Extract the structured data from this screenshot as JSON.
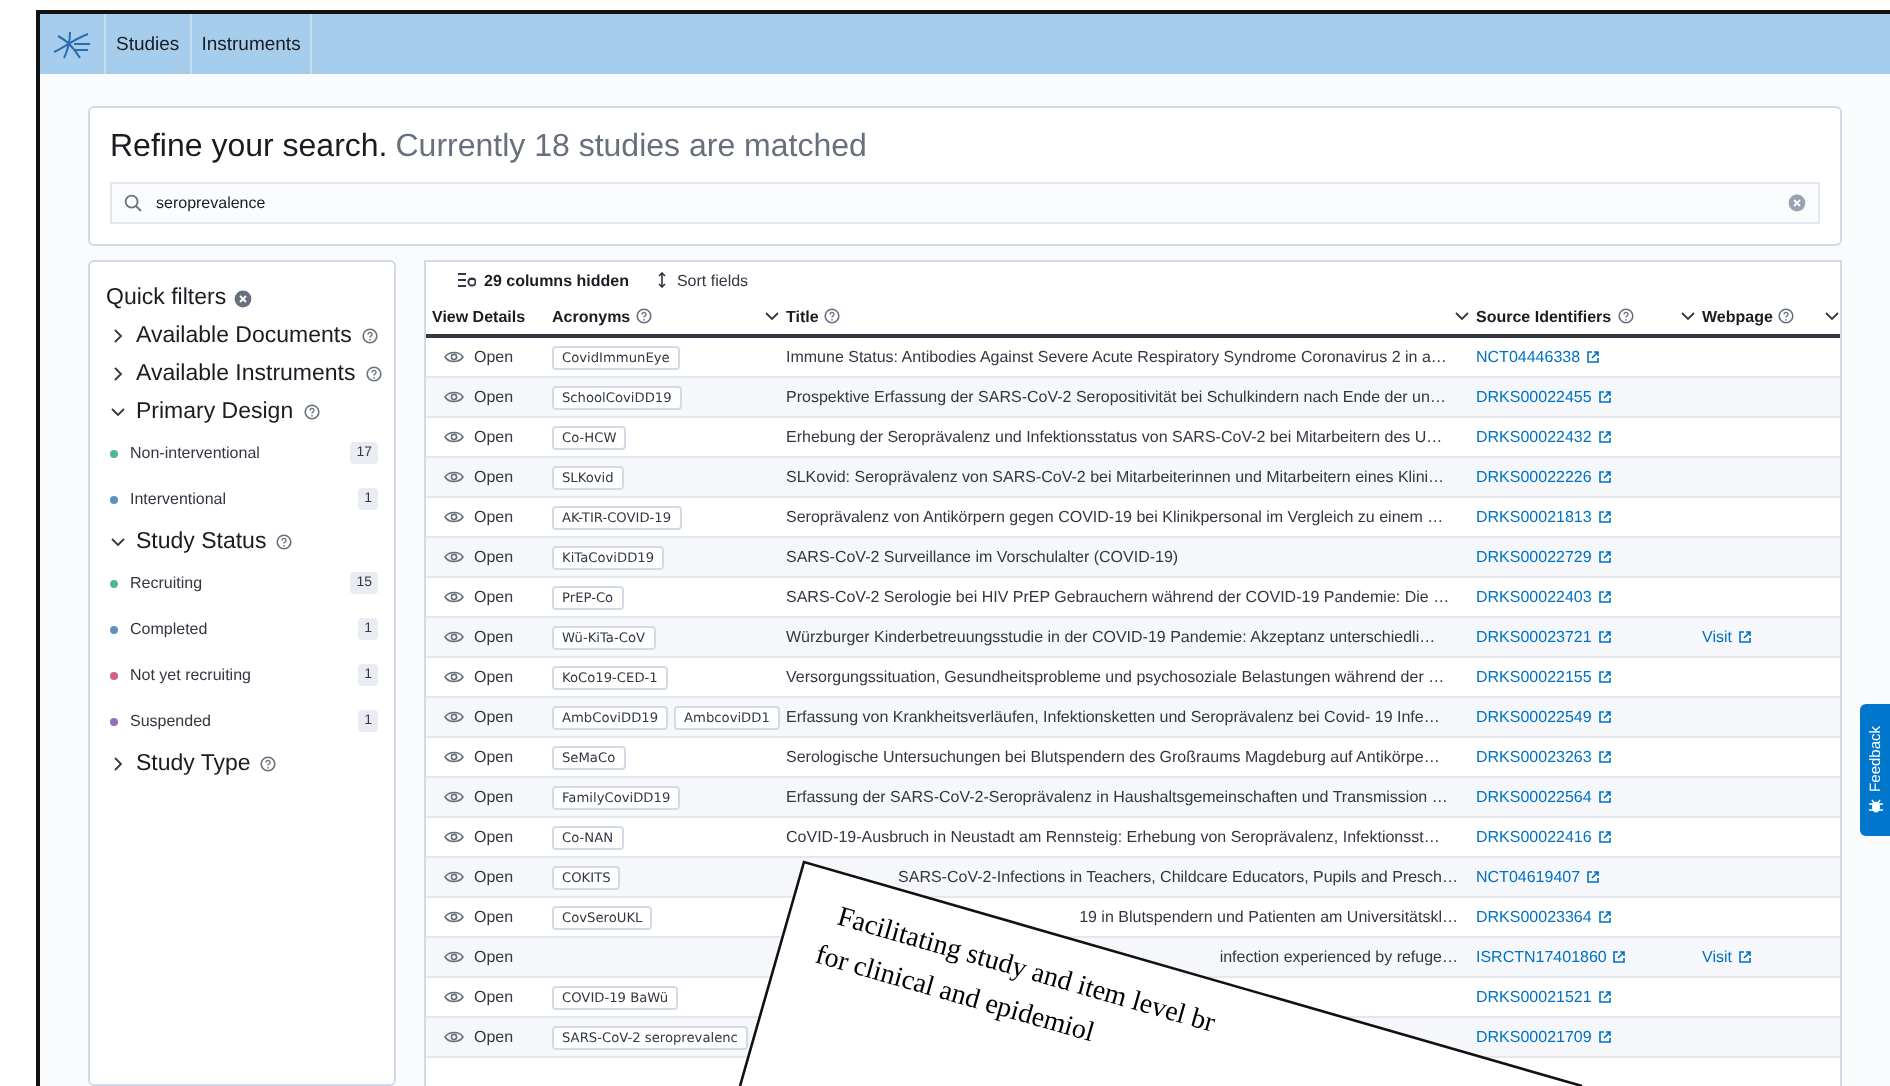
{
  "nav": {
    "items": [
      {
        "label": "Studies"
      },
      {
        "label": "Instruments"
      }
    ]
  },
  "search": {
    "title": "Refine your search.",
    "subtitle": "Currently 18 studies are matched",
    "value": "seroprevalence"
  },
  "filters": {
    "title": "Quick filters",
    "sections": [
      {
        "label": "Available Documents",
        "expanded": false
      },
      {
        "label": "Available Instruments",
        "expanded": false
      },
      {
        "label": "Primary Design",
        "expanded": true,
        "items": [
          {
            "label": "Non-interventional",
            "count": "17",
            "color": "#54b399"
          },
          {
            "label": "Interventional",
            "count": "1",
            "color": "#6092c0"
          }
        ]
      },
      {
        "label": "Study Status",
        "expanded": true,
        "items": [
          {
            "label": "Recruiting",
            "count": "15",
            "color": "#54b399"
          },
          {
            "label": "Completed",
            "count": "1",
            "color": "#6092c0"
          },
          {
            "label": "Not yet recruiting",
            "count": "1",
            "color": "#d36086"
          },
          {
            "label": "Suspended",
            "count": "1",
            "color": "#9170b8"
          }
        ]
      },
      {
        "label": "Study Type",
        "expanded": false
      }
    ]
  },
  "table": {
    "hidden_columns": "29 columns hidden",
    "sort": "Sort fields",
    "columns": [
      {
        "label": "View Details",
        "help": false,
        "menu": false
      },
      {
        "label": "Acronyms",
        "help": true,
        "menu": true
      },
      {
        "label": "Title",
        "help": true,
        "menu": true
      },
      {
        "label": "Source Identifiers",
        "help": true,
        "menu": true
      },
      {
        "label": "Webpage",
        "help": true,
        "menu": true
      }
    ],
    "rows": [
      {
        "action": "Open",
        "acronyms": [
          "CovidImmunEye"
        ],
        "title": "Immune Status: Antibodies Against Severe Acute Respiratory Syndrome Coronavirus 2 in a…",
        "title_covered": false,
        "source": "NCT04446338"
      },
      {
        "action": "Open",
        "acronyms": [
          "SchoolCoviDD19"
        ],
        "title": "Prospektive Erfassung der SARS-CoV-2 Seropositivität bei Schulkindern nach Ende der un…",
        "title_covered": false,
        "source": "DRKS00022455"
      },
      {
        "action": "Open",
        "acronyms": [
          "Co-HCW"
        ],
        "title": "Erhebung der Seroprävalenz und Infektionsstatus von SARS-CoV-2 bei Mitarbeitern des U…",
        "title_covered": false,
        "source": "DRKS00022432"
      },
      {
        "action": "Open",
        "acronyms": [
          "SLKovid"
        ],
        "title": "SLKovid: Seroprävalenz von SARS-CoV-2 bei Mitarbeiterinnen und Mitarbeitern eines Klini…",
        "title_covered": false,
        "source": "DRKS00022226"
      },
      {
        "action": "Open",
        "acronyms": [
          "AK-TIR-COVID-19"
        ],
        "title": "Seroprävalenz von Antikörpern gegen COVID-19 bei Klinikpersonal im Vergleich zu einem …",
        "title_covered": false,
        "source": "DRKS00021813"
      },
      {
        "action": "Open",
        "acronyms": [
          "KiTaCoviDD19"
        ],
        "title": "SARS-CoV-2 Surveillance im Vorschulalter (COVID-19)",
        "title_covered": false,
        "source": "DRKS00022729"
      },
      {
        "action": "Open",
        "acronyms": [
          "PrEP-Co"
        ],
        "title": "SARS-CoV-2 Serologie bei HIV PrEP Gebrauchern während der COVID-19 Pandemie: Die …",
        "title_covered": false,
        "source": "DRKS00022403"
      },
      {
        "action": "Open",
        "acronyms": [
          "Wü-KiTa-CoV"
        ],
        "title": "Würzburger Kinderbetreuungsstudie in der COVID-19 Pandemie: Akzeptanz unterschiedli…",
        "title_covered": false,
        "source": "DRKS00023721",
        "webpage": "Visit"
      },
      {
        "action": "Open",
        "acronyms": [
          "KoCo19-CED-1"
        ],
        "title": "Versorgungssituation, Gesundheitsprobleme und psychosoziale Belastungen während der …",
        "title_covered": false,
        "source": "DRKS00022155"
      },
      {
        "action": "Open",
        "acronyms": [
          "AmbCoviDD19",
          "AmbcoviDD1"
        ],
        "title": "Erfassung von Krankheitsverläufen, Infektionsketten und Seroprävalenz bei Covid- 19 Infe…",
        "title_covered": false,
        "source": "DRKS00022549"
      },
      {
        "action": "Open",
        "acronyms": [
          "SeMaCo"
        ],
        "title": "Serologische Untersuchungen bei Blutspendern des Großraums Magdeburg auf Antikörpe…",
        "title_covered": false,
        "source": "DRKS00023263"
      },
      {
        "action": "Open",
        "acronyms": [
          "FamilyCoviDD19"
        ],
        "title": "Erfassung der SARS-CoV-2-Seroprävalenz in Haushaltsgemeinschaften und Transmission …",
        "title_covered": false,
        "source": "DRKS00022564"
      },
      {
        "action": "Open",
        "acronyms": [
          "Co-NAN"
        ],
        "title": "CoVID-19-Ausbruch in Neustadt am Rennsteig: Erhebung von Seroprävalenz, Infektionsst…",
        "title_covered": false,
        "source": "DRKS00022416"
      },
      {
        "action": "Open",
        "acronyms": [
          "COKITS"
        ],
        "title": "SARS-CoV-2-Infections in Teachers, Childcare Educators, Pupils and Presch…",
        "title_covered": true,
        "source": "NCT04619407"
      },
      {
        "action": "Open",
        "acronyms": [
          "CovSeroUKL"
        ],
        "title": "19 in Blutspendern und Patienten am Universitätskl…",
        "title_covered": true,
        "source": "DRKS00023364"
      },
      {
        "action": "Open",
        "title": "infection experienced by refuge…",
        "title_covered": true,
        "source": "ISRCTN17401860",
        "webpage": "Visit"
      },
      {
        "action": "Open",
        "acronyms": [
          "COVID-19 BaWü"
        ],
        "source": "DRKS00021521"
      },
      {
        "action": "Open",
        "acronyms": [
          "SARS-CoV-2 seroprevalenc"
        ],
        "source": "DRKS00021709"
      }
    ]
  },
  "feedback": {
    "label": "Feedback"
  },
  "overlay": {
    "lines": [
      "Facilitating study and item level br",
      "for clinical and epidemiol"
    ]
  }
}
